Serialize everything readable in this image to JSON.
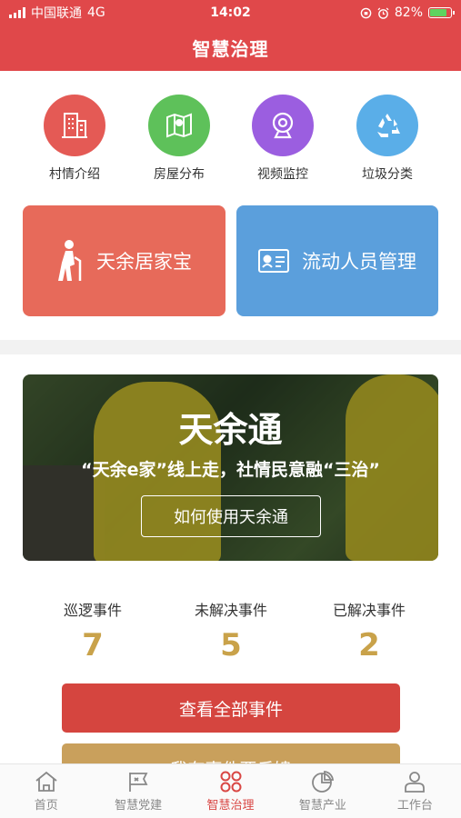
{
  "status_bar": {
    "carrier": "中国联通",
    "network": "4G",
    "time": "14:02",
    "battery": "82%",
    "battery_level": 0.82
  },
  "header": {
    "title": "智慧治理"
  },
  "quick_icons": [
    {
      "label": "村情介绍",
      "icon": "building-icon",
      "color": "#e45a55"
    },
    {
      "label": "房屋分布",
      "icon": "map-icon",
      "color": "#5ec15a"
    },
    {
      "label": "视频监控",
      "icon": "camera-icon",
      "color": "#9b5ee0"
    },
    {
      "label": "垃圾分类",
      "icon": "recycle-icon",
      "color": "#5aaee8"
    }
  ],
  "feature_buttons": [
    {
      "label": "天余居家宝",
      "icon": "elderly-person-icon",
      "color": "#e76a5a"
    },
    {
      "label": "流动人员管理",
      "icon": "id-card-icon",
      "color": "#5b9fdc"
    }
  ],
  "banner": {
    "title": "天余通",
    "subtitle": "“天余e家”线上走，社情民意融“三治”",
    "button": "如何使用天余通"
  },
  "stats": [
    {
      "label": "巡逻事件",
      "value": "7"
    },
    {
      "label": "未解决事件",
      "value": "5"
    },
    {
      "label": "已解决事件",
      "value": "2"
    }
  ],
  "actions": {
    "view_all": "查看全部事件",
    "report": "我有事件要反馈"
  },
  "tabbar": {
    "active": 2,
    "items": [
      {
        "label": "首页",
        "icon": "home-icon"
      },
      {
        "label": "智慧党建",
        "icon": "flag-icon"
      },
      {
        "label": "智慧治理",
        "icon": "grid-icon"
      },
      {
        "label": "智慧产业",
        "icon": "pie-chart-icon"
      },
      {
        "label": "工作台",
        "icon": "user-icon"
      }
    ]
  },
  "colors": {
    "brand_red": "#e0484a",
    "gold": "#c9a24a"
  }
}
